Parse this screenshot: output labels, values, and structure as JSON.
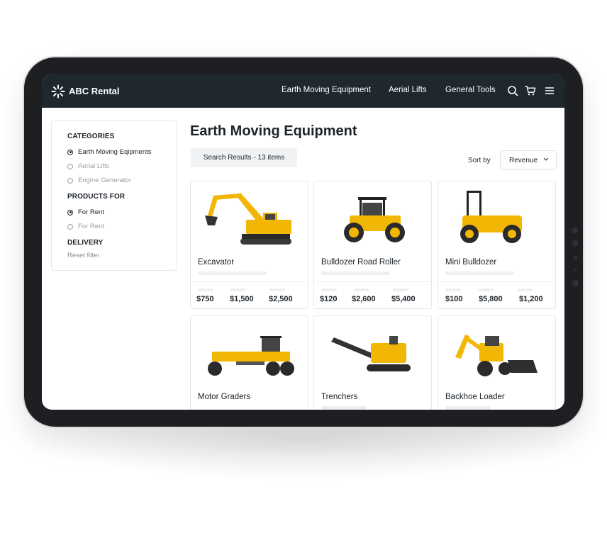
{
  "nav": {
    "brand": "ABC Rental",
    "links": [
      "Earth Moving Equipment",
      "Aerial Lifts",
      "General Tools"
    ],
    "icons": [
      "search-icon",
      "cart-icon",
      "menu-icon"
    ]
  },
  "sidebar": {
    "categories_title": "CATEGORIES",
    "categories": [
      {
        "label": "Earth Moving Eqipments",
        "selected": true
      },
      {
        "label": "Aerial Lifts",
        "selected": false
      },
      {
        "label": "Engine Generator",
        "selected": false
      }
    ],
    "products_for_title": "PRODUCTS FOR",
    "products_for": [
      {
        "label": "For Rent",
        "selected": true
      },
      {
        "label": "For Rent",
        "selected": false
      }
    ],
    "delivery_title": "DELIVERY",
    "reset": "Reset filter"
  },
  "main": {
    "title": "Earth Moving Equipment",
    "results": "Search Results - 13 items",
    "sort_label": "Sort by",
    "sort_value": "Revenue"
  },
  "products": [
    {
      "name": "Excavator",
      "prices": [
        "$750",
        "$1,500",
        "$2,500"
      ]
    },
    {
      "name": "Bulldozer Road Roller",
      "prices": [
        "$120",
        "$2,600",
        "$5,400"
      ]
    },
    {
      "name": "Mini Bulldozer",
      "prices": [
        "$100",
        "$5,800",
        "$1,200"
      ]
    },
    {
      "name": "Motor Graders",
      "prices": []
    },
    {
      "name": "Trenchers",
      "prices": []
    },
    {
      "name": "Backhoe Loader",
      "prices": []
    }
  ],
  "colors": {
    "nav_bg": "#1f282f",
    "accent_yellow": "#f2b705",
    "text": "#1c2329"
  }
}
